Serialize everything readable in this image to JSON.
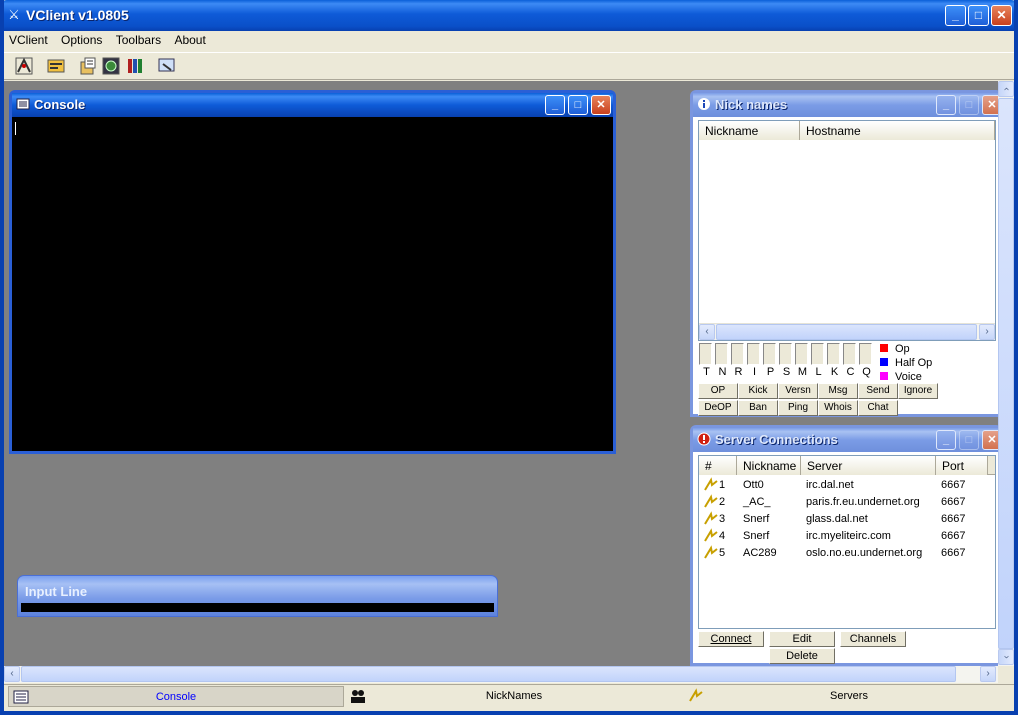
{
  "app": {
    "title": "VClient v1.0805"
  },
  "menu": [
    "VClient",
    "Options",
    "Toolbars",
    "About"
  ],
  "toolbar_icons": [
    "connect-icon",
    "channel-list-icon",
    "script-icon",
    "globe-icon",
    "books-icon",
    "dcc-icon"
  ],
  "console": {
    "title": "Console"
  },
  "input_line": {
    "title": "Input Line"
  },
  "nicknames": {
    "title": "Nick names",
    "columns": [
      "Nickname",
      "Hostname"
    ],
    "modes": [
      "T",
      "N",
      "R",
      "I",
      "P",
      "S",
      "M",
      "L",
      "K",
      "C",
      "Q"
    ],
    "legend": [
      {
        "label": "Op",
        "color": "#ff0000"
      },
      {
        "label": "Half Op",
        "color": "#0000ff"
      },
      {
        "label": "Voice",
        "color": "#ff00ff"
      }
    ],
    "buttons_row1": [
      "OP",
      "Kick",
      "Versn",
      "Msg",
      "Send",
      "Ignore"
    ],
    "buttons_row2": [
      "DeOP",
      "Ban",
      "Ping",
      "Whois",
      "Chat"
    ]
  },
  "servers": {
    "title": "Server Connections",
    "columns": [
      "#",
      "Nickname",
      "Server",
      "Port"
    ],
    "rows": [
      {
        "num": "1",
        "nick": "Ott0",
        "server": "irc.dal.net",
        "port": "6667"
      },
      {
        "num": "2",
        "nick": "_AC_",
        "server": "paris.fr.eu.undernet.org",
        "port": "6667"
      },
      {
        "num": "3",
        "nick": "Snerf",
        "server": "glass.dal.net",
        "port": "6667"
      },
      {
        "num": "4",
        "nick": "Snerf",
        "server": "irc.myeliteirc.com",
        "port": "6667"
      },
      {
        "num": "5",
        "nick": "AC289",
        "server": "oslo.no.eu.undernet.org",
        "port": "6667"
      }
    ],
    "buttons": {
      "connect": "Connect",
      "edit": "Edit",
      "channels": "Channels",
      "delete": "Delete"
    }
  },
  "window_tabs": [
    {
      "label": "Console",
      "icon": "console-icon",
      "active": true
    },
    {
      "label": "NickNames",
      "icon": "users-icon",
      "active": false
    },
    {
      "label": "Servers",
      "icon": "plug-icon",
      "active": false
    }
  ]
}
